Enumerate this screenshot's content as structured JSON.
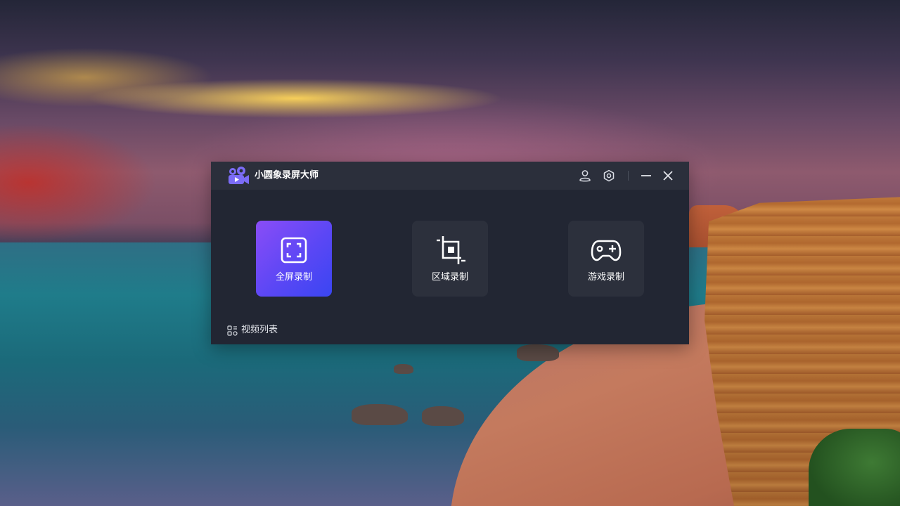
{
  "app": {
    "title": "小圆象录屏大师",
    "accent_gradient": [
      "#8a4df6",
      "#3a46f2"
    ],
    "logo_color": "#7b6cf6"
  },
  "titlebar": {
    "icons": [
      "user-icon",
      "settings-icon",
      "minimize-icon",
      "close-icon"
    ]
  },
  "modes": [
    {
      "label": "全屏录制",
      "icon": "fullscreen-icon",
      "selected": true
    },
    {
      "label": "区域录制",
      "icon": "crop-icon",
      "selected": false
    },
    {
      "label": "游戏录制",
      "icon": "gamepad-icon",
      "selected": false
    }
  ],
  "footer": {
    "video_list_label": "视频列表",
    "video_list_icon": "grid-list-icon"
  }
}
